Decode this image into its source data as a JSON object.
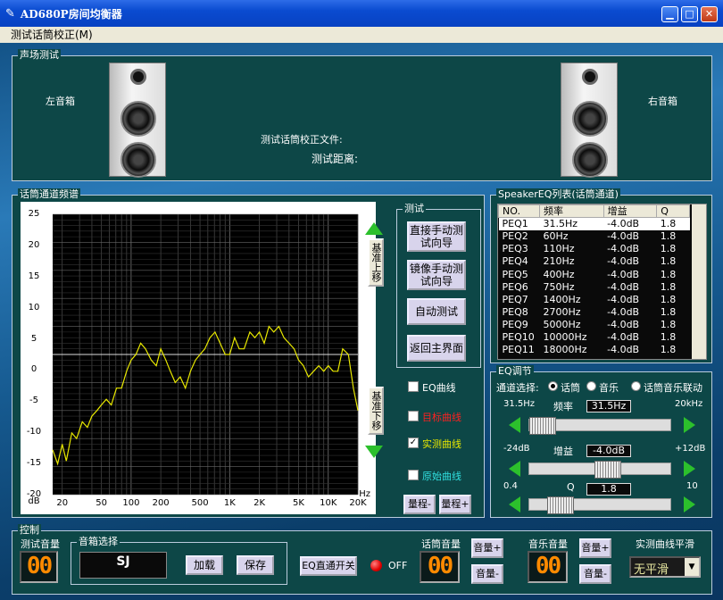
{
  "window": {
    "title": "AD680P房间均衡器"
  },
  "menu": {
    "items": [
      "测试话筒校正(M)"
    ]
  },
  "sound_field": {
    "panel_title": "声场测试",
    "left_label": "左音箱",
    "right_label": "右音箱",
    "calib_file_label": "测试话筒校正文件:",
    "distance_label": "测试距离:"
  },
  "freq_panel": {
    "title": "话筒通道频谱",
    "y_ticks": [
      "25",
      "20",
      "15",
      "10",
      "5",
      "0",
      "-5",
      "-10",
      "-15",
      "-20",
      "dB"
    ],
    "x_ticks": [
      "20",
      "50",
      "100",
      "200",
      "500",
      "1K",
      "2K",
      "5K",
      "10K",
      "20K"
    ],
    "x_unit": "Hz",
    "shift_up": "基准上移",
    "shift_down": "基准下移"
  },
  "chart_data": {
    "type": "line",
    "x_scale": "log",
    "xlim": [
      16,
      20000
    ],
    "ylim": [
      -25,
      25
    ],
    "xlabel": "Hz",
    "ylabel": "dB",
    "grid": true,
    "reference_line": 0,
    "series": [
      {
        "color": "#e8e800",
        "x": [
          16,
          18,
          20,
          22,
          25,
          28,
          32,
          36,
          40,
          45,
          50,
          56,
          63,
          71,
          80,
          90,
          100,
          112,
          125,
          140,
          160,
          180,
          200,
          225,
          250,
          280,
          315,
          355,
          400,
          450,
          500,
          560,
          630,
          710,
          800,
          900,
          1000,
          1120,
          1250,
          1400,
          1600,
          1800,
          2000,
          2240,
          2500,
          2800,
          3150,
          3550,
          4000,
          4500,
          5000,
          5600,
          6300,
          7100,
          8000,
          9000,
          10000,
          11200,
          12500,
          14000,
          16000,
          18000,
          20000
        ],
        "y": [
          -17,
          -19.5,
          -16,
          -19,
          -14,
          -15,
          -12,
          -13,
          -11,
          -10,
          -9,
          -8,
          -9,
          -6,
          -6,
          -3,
          -1,
          0,
          2,
          1,
          -1,
          -2,
          1,
          -1,
          -3,
          -5,
          -4,
          -6,
          -3,
          -1,
          0,
          1,
          3,
          4,
          2,
          0,
          0,
          3,
          1,
          1,
          4,
          3,
          4,
          2,
          5,
          4,
          5,
          3,
          2,
          1,
          -1,
          -2,
          -4,
          -3,
          -2,
          -3,
          -2,
          -3,
          -3,
          1,
          0,
          -6,
          -10
        ]
      }
    ]
  },
  "test_panel": {
    "title": "测试",
    "btn_direct": "直接手动测试向导",
    "btn_mirror": "镜像手动测试向导",
    "btn_auto": "自动测试",
    "btn_back": "返回主界面",
    "eq_curve": "EQ曲线",
    "target_curve": "目标曲线",
    "measured_curve": "实测曲线",
    "raw_curve": "原始曲线",
    "range_minus": "量程-",
    "range_plus": "量程+",
    "target_color": "#ff2020",
    "measured_color": "#e8e800",
    "raw_color": "#30e0e0"
  },
  "peq_panel": {
    "title": "SpeakerEQ列表(话筒通道)",
    "headers": [
      "NO.",
      "频率",
      "增益",
      "Q"
    ],
    "rows": [
      [
        "PEQ1",
        "31.5Hz",
        "-4.0dB",
        "1.8"
      ],
      [
        "PEQ2",
        "60Hz",
        "-4.0dB",
        "1.8"
      ],
      [
        "PEQ3",
        "110Hz",
        "-4.0dB",
        "1.8"
      ],
      [
        "PEQ4",
        "210Hz",
        "-4.0dB",
        "1.8"
      ],
      [
        "PEQ5",
        "400Hz",
        "-4.0dB",
        "1.8"
      ],
      [
        "PEQ6",
        "750Hz",
        "-4.0dB",
        "1.8"
      ],
      [
        "PEQ7",
        "1400Hz",
        "-4.0dB",
        "1.8"
      ],
      [
        "PEQ8",
        "2700Hz",
        "-4.0dB",
        "1.8"
      ],
      [
        "PEQ9",
        "5000Hz",
        "-4.0dB",
        "1.8"
      ],
      [
        "PEQ10",
        "10000Hz",
        "-4.0dB",
        "1.8"
      ],
      [
        "PEQ11",
        "18000Hz",
        "-4.0dB",
        "1.8"
      ]
    ]
  },
  "eq_adjust": {
    "title": "EQ调节",
    "channel_label": "通道选择:",
    "radio_mic": "话筒",
    "radio_music": "音乐",
    "radio_link": "话筒音乐联动",
    "freq_min": "31.5Hz",
    "freq_label": "频率",
    "freq_value": "31.5Hz",
    "freq_max": "20kHz",
    "gain_min": "-24dB",
    "gain_label": "增益",
    "gain_value": "-4.0dB",
    "gain_max": "+12dB",
    "q_min": "0.4",
    "q_label": "Q",
    "q_value": "1.8",
    "q_max": "10",
    "freq_level": 0.0,
    "gain_level": 0.56,
    "q_level": 0.15
  },
  "control": {
    "title": "控制",
    "test_vol_label": "测试音量",
    "test_vol_value": "00",
    "speaker_select_label": "音箱选择",
    "speaker_name": "SJ",
    "btn_load": "加载",
    "btn_save": "保存",
    "btn_eq_bypass": "EQ直通开关",
    "eq_state": "OFF",
    "mic_vol_label": "话筒音量",
    "mic_vol_value": "00",
    "mic_vol_plus": "音量+",
    "mic_vol_minus": "音量-",
    "music_vol_label": "音乐音量",
    "music_vol_value": "00",
    "music_vol_plus": "音量+",
    "music_vol_minus": "音量-",
    "smooth_label": "实测曲线平滑",
    "smooth_value": "无平滑"
  }
}
